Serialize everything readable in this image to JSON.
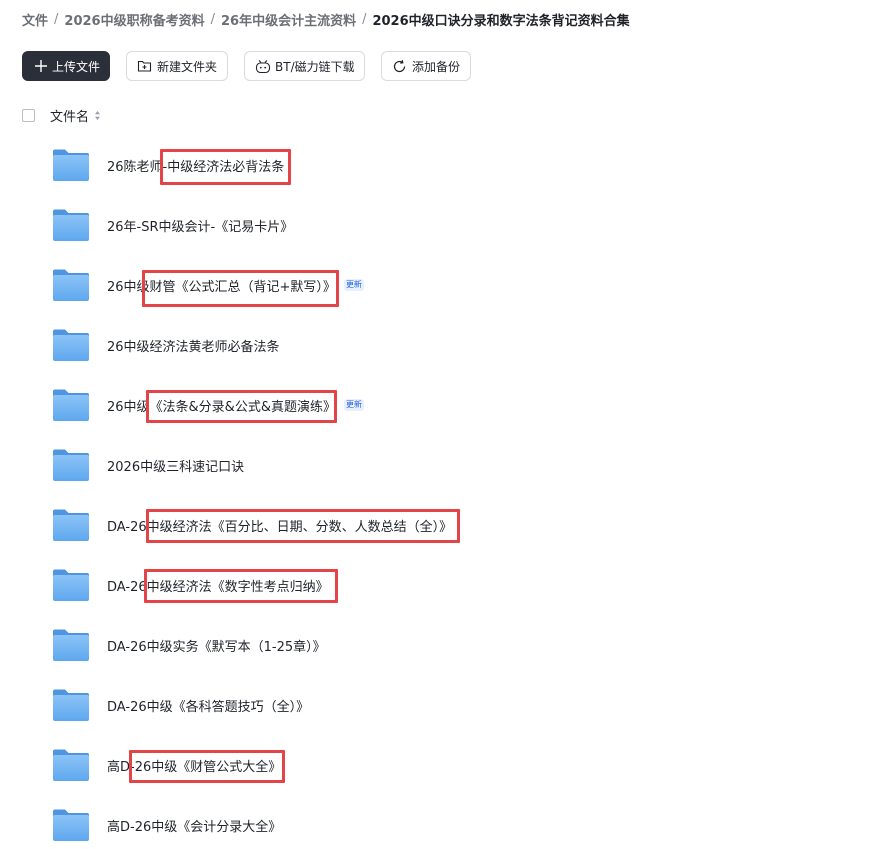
{
  "breadcrumb": {
    "items": [
      "文件",
      "2026中级职称备考资料",
      "26年中级会计主流资料",
      "2026中级口诀分录和数字法条背记资料合集"
    ],
    "separator": "/"
  },
  "toolbar": {
    "upload_label": "上传文件",
    "new_folder_label": "新建文件夹",
    "bt_label": "BT/磁力链下载",
    "backup_label": "添加备份"
  },
  "list_header": {
    "name_label": "文件名"
  },
  "files": [
    {
      "name": "26陈老师-中级经济法必背法条",
      "badge": ""
    },
    {
      "name": "26年-SR中级会计-《记易卡片》",
      "badge": ""
    },
    {
      "name": "26中级财管《公式汇总（背记+默写）》",
      "badge": "更新"
    },
    {
      "name": "26中级经济法黄老师必备法条",
      "badge": ""
    },
    {
      "name": "26中级《法条&分录&公式&真题演练》",
      "badge": "更新"
    },
    {
      "name": "2026中级三科速记口诀",
      "badge": ""
    },
    {
      "name": "DA-26中级经济法《百分比、日期、分数、人数总结（全）》",
      "badge": ""
    },
    {
      "name": "DA-26中级经济法《数字性考点归纳》",
      "badge": ""
    },
    {
      "name": "DA-26中级实务《默写本（1-25章）》",
      "badge": ""
    },
    {
      "name": "DA-26中级《各科答题技巧（全）》",
      "badge": ""
    },
    {
      "name": "高D-26中级《财管公式大全》",
      "badge": ""
    },
    {
      "name": "高D-26中级《会计分录大全》",
      "badge": ""
    }
  ],
  "colors": {
    "highlight": "#e24447",
    "folder": "#6aaef0",
    "primary_button": "#2b2f3a",
    "badge": "#1e5fd8"
  },
  "icons": [
    "plus-icon",
    "new-folder-icon",
    "bt-magnet-icon",
    "backup-icon",
    "sort-icon",
    "folder-icon"
  ]
}
